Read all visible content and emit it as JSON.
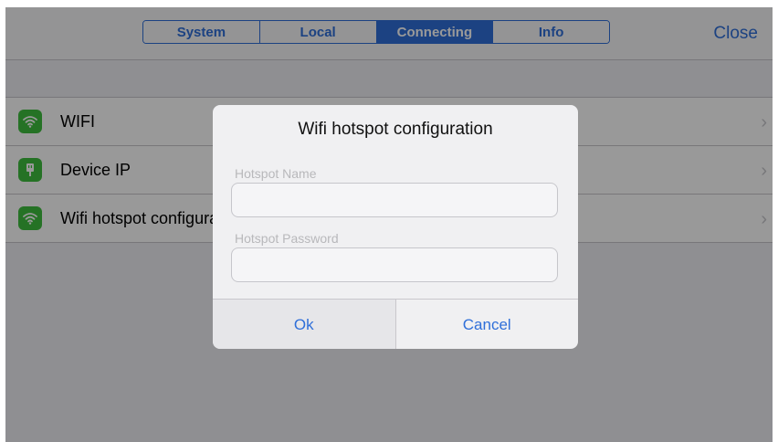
{
  "tabs": [
    {
      "label": "System",
      "active": false
    },
    {
      "label": "Local",
      "active": false
    },
    {
      "label": "Connecting",
      "active": true
    },
    {
      "label": "Info",
      "active": false
    }
  ],
  "nav": {
    "close_label": "Close"
  },
  "list": {
    "items": [
      {
        "label": "WIFI",
        "icon": "wifi-icon"
      },
      {
        "label": "Device IP",
        "icon": "ethernet-plug-icon"
      },
      {
        "label": "Wifi hotspot configuration",
        "icon": "wifi-icon"
      }
    ]
  },
  "dialog": {
    "title": "Wifi hotspot configuration",
    "name_label": "Hotspot Name",
    "name_value": "",
    "password_label": "Hotspot Password",
    "password_value": "",
    "ok_label": "Ok",
    "cancel_label": "Cancel"
  },
  "colors": {
    "accent": "#2f6fd9",
    "icon_green": "#3fbf3f"
  }
}
